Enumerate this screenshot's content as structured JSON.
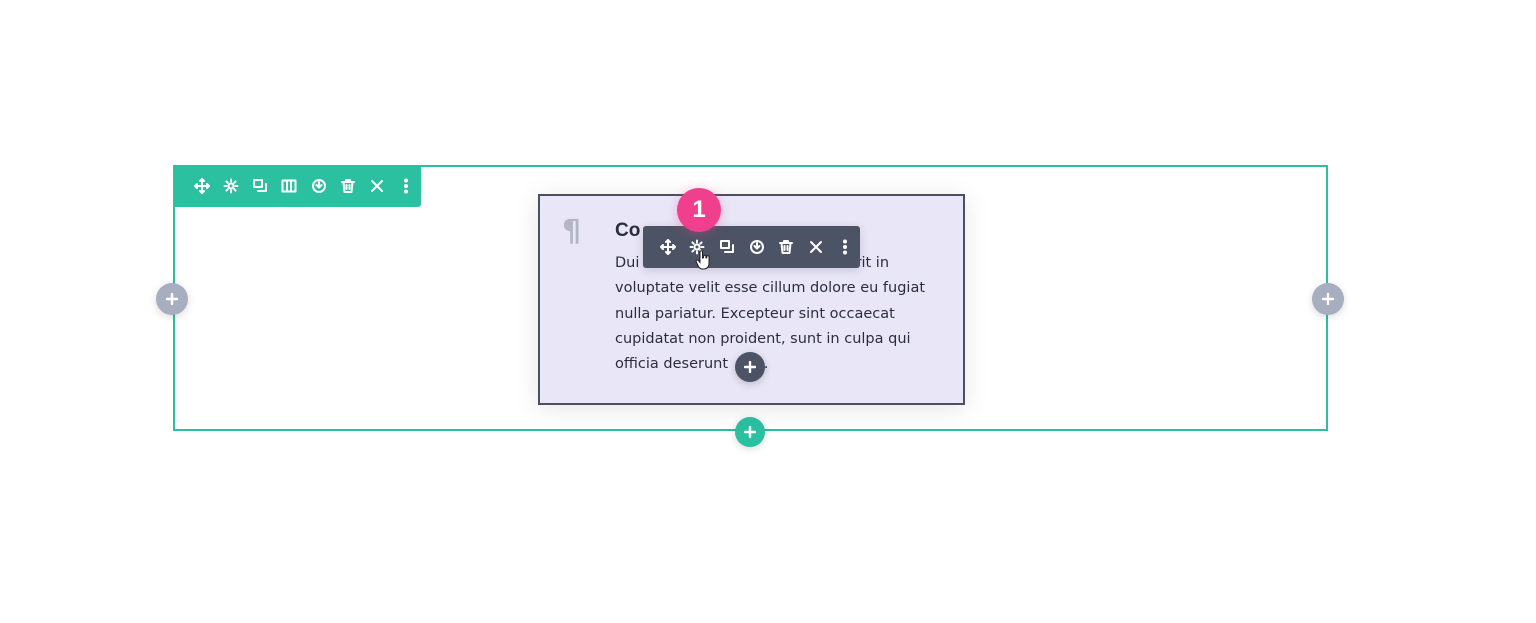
{
  "row": {
    "accent_color": "#2bc0a0",
    "toolbar_icons": [
      "move-icon",
      "gear-icon",
      "duplicate-icon",
      "columns-icon",
      "save-icon",
      "trash-icon",
      "close-icon",
      "more-icon"
    ]
  },
  "module": {
    "title": "Co",
    "body_lines": [
      "Dui",
      "derit in",
      "voluptate velit esse cillum dolore eu fugiat",
      "nulla pariatur. Excepteur sint occaecat",
      "cupidatat non proident, sunt in culpa qui",
      "officia deserunt",
      "lit."
    ],
    "toolbar_color": "#4c5364",
    "toolbar_icons": [
      "move-icon",
      "gear-icon",
      "duplicate-icon",
      "save-icon",
      "trash-icon",
      "close-icon",
      "more-icon"
    ]
  },
  "step_badge": {
    "label": "1",
    "color": "#f0408d"
  }
}
